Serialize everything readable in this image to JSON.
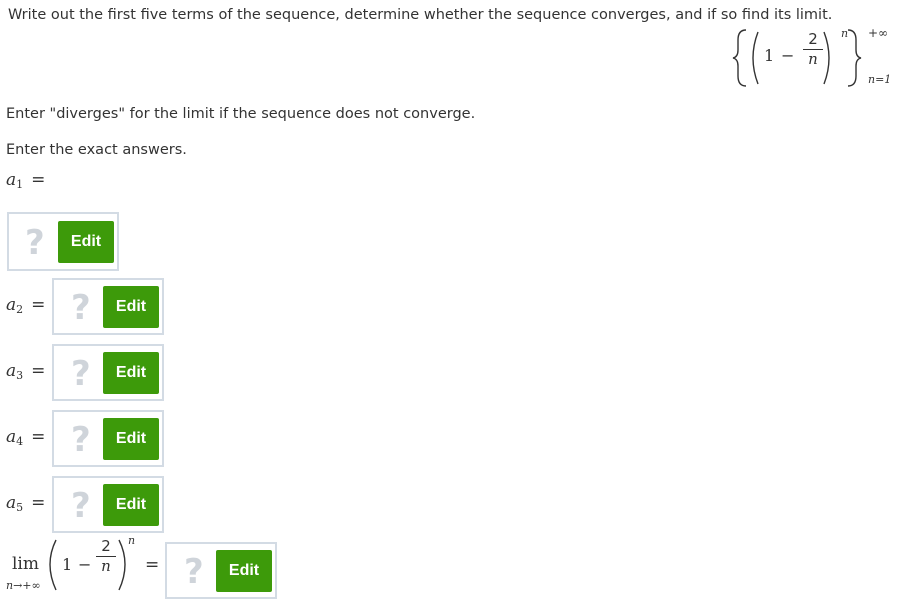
{
  "instruction": "Write out the first five terms of the sequence, determine whether the sequence converges, and if so find its limit.",
  "sequence": {
    "one": "1",
    "minus": "−",
    "numerator": "2",
    "denominator": "n",
    "exponent": "n",
    "upper": "+∞",
    "lower": "n=1"
  },
  "note_diverges": "Enter \"diverges\" for the limit if the sequence does not converge.",
  "note_exact": "Enter the exact answers.",
  "terms": [
    {
      "var": "a",
      "sub": "1",
      "eq": "="
    },
    {
      "var": "a",
      "sub": "2",
      "eq": "="
    },
    {
      "var": "a",
      "sub": "3",
      "eq": "="
    },
    {
      "var": "a",
      "sub": "4",
      "eq": "="
    },
    {
      "var": "a",
      "sub": "5",
      "eq": "="
    }
  ],
  "limit": {
    "lim": "lim",
    "under": "n→+∞",
    "one": "1",
    "minus": "−",
    "numerator": "2",
    "denominator": "n",
    "exponent": "n",
    "eq": "="
  },
  "placeholder_glyph": "?",
  "edit_label": "Edit",
  "colors": {
    "edit_green": "#3d9a0a",
    "box_border": "#d3dbe4",
    "placeholder": "#cfd4da"
  }
}
